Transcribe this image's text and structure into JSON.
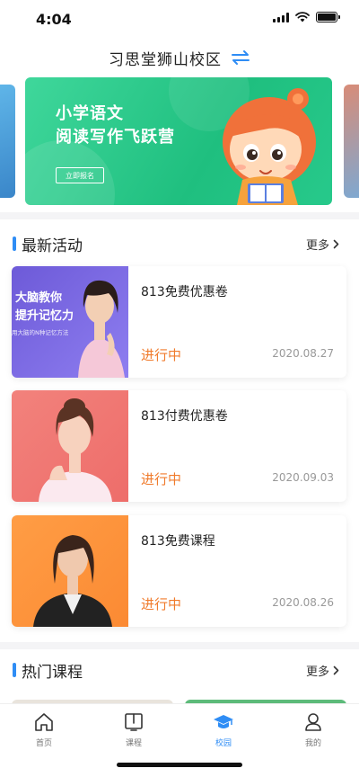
{
  "status_bar": {
    "time": "4:04"
  },
  "header": {
    "title": "习思堂狮山校区"
  },
  "banner": {
    "title_line1": "小学语文",
    "title_line2": "阅读写作飞跃营",
    "button_label": "立即报名"
  },
  "sections": {
    "activities": {
      "title": "最新活动",
      "more_label": "更多"
    },
    "hot_courses": {
      "title": "热门课程",
      "more_label": "更多"
    }
  },
  "activities": [
    {
      "title": "813免费优惠卷",
      "status": "进行中",
      "date": "2020.08.27",
      "image_text1": "大脑教你",
      "image_text2": "提升记忆力",
      "image_text3": "用大脑的N种记忆方法"
    },
    {
      "title": "813付费优惠卷",
      "status": "进行中",
      "date": "2020.09.03"
    },
    {
      "title": "813免费课程",
      "status": "进行中",
      "date": "2020.08.26"
    }
  ],
  "tabbar": {
    "items": [
      {
        "label": "首页",
        "icon": "home-icon"
      },
      {
        "label": "课程",
        "icon": "book-icon"
      },
      {
        "label": "校园",
        "icon": "graduation-cap-icon"
      },
      {
        "label": "我的",
        "icon": "profile-icon"
      }
    ],
    "active_index": 2
  },
  "colors": {
    "accent": "#2f8df5",
    "status": "#f07b2c",
    "banner": "#1fbf7f"
  }
}
